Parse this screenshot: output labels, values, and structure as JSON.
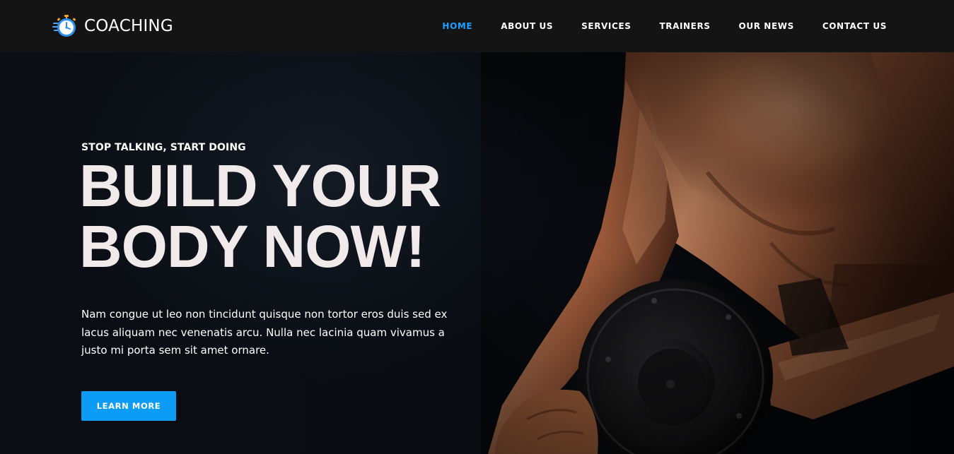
{
  "header": {
    "logo": {
      "text": "COACHING",
      "icon": "stopwatch-icon"
    },
    "nav": [
      {
        "label": "HOME",
        "active": true
      },
      {
        "label": "ABOUT US",
        "active": false
      },
      {
        "label": "SERVICES",
        "active": false
      },
      {
        "label": "TRAINERS",
        "active": false
      },
      {
        "label": "OUR NEWS",
        "active": false
      },
      {
        "label": "CONTACT US",
        "active": false
      }
    ]
  },
  "hero": {
    "eyebrow": "STOP TALKING, START DOING",
    "headline_line1": "BUILD YOUR",
    "headline_line2": "BODY NOW!",
    "lead": "Nam congue ut leo non tincidunt quisque non tortor eros duis sed ex lacus aliquam nec venenatis arcu. Nulla nec lacinia quam vivamus a justo mi porta sem sit amet ornare.",
    "cta_label": "LEARN MORE",
    "image": "athlete-lifting-dumbbell"
  },
  "colors": {
    "accent": "#0c9cf5",
    "nav_active": "#1aa0ff",
    "header_bg": "#141414",
    "hero_bg": "#080b10",
    "headline": "#f1eaea"
  }
}
